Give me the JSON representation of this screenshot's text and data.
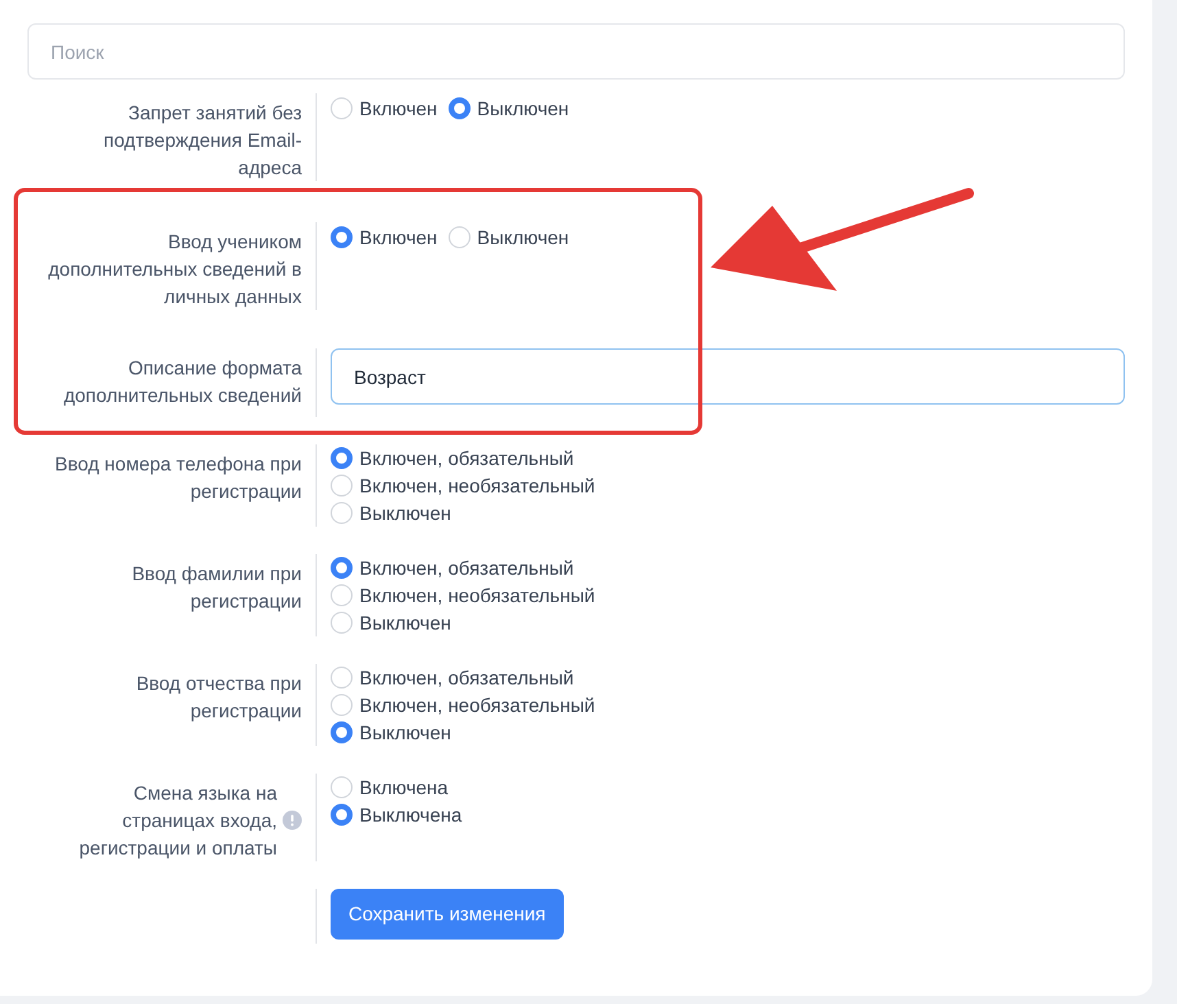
{
  "search": {
    "placeholder": "Поиск"
  },
  "settings": [
    {
      "kind": "radio_inline",
      "label": "Запрет занятий без подтверждения Email-адреса",
      "options": [
        {
          "label": "Включен",
          "selected": false
        },
        {
          "label": "Выключен",
          "selected": true
        }
      ]
    },
    {
      "kind": "radio_inline",
      "label": "Ввод учеником дополнительных сведений в личных данных",
      "highlighted": true,
      "options": [
        {
          "label": "Включен",
          "selected": true
        },
        {
          "label": "Выключен",
          "selected": false
        }
      ]
    },
    {
      "kind": "text",
      "label": "Описание формата дополнительных сведений",
      "highlighted": true,
      "value": "Возраст"
    },
    {
      "kind": "radio_stacked",
      "label": "Ввод номера телефона при регистрации",
      "options": [
        {
          "label": "Включен, обязательный",
          "selected": true
        },
        {
          "label": "Включен, необязательный",
          "selected": false
        },
        {
          "label": "Выключен",
          "selected": false
        }
      ]
    },
    {
      "kind": "radio_stacked",
      "label": "Ввод фамилии при регистрации",
      "options": [
        {
          "label": "Включен, обязательный",
          "selected": true
        },
        {
          "label": "Включен, необязательный",
          "selected": false
        },
        {
          "label": "Выключен",
          "selected": false
        }
      ]
    },
    {
      "kind": "radio_stacked",
      "label": "Ввод отчества при регистрации",
      "options": [
        {
          "label": "Включен, обязательный",
          "selected": false
        },
        {
          "label": "Включен, необязательный",
          "selected": false
        },
        {
          "label": "Выключен",
          "selected": true
        }
      ]
    },
    {
      "kind": "radio_stacked",
      "label": "Смена языка на страницах входа, регистрации и оплаты",
      "help_icon": true,
      "options": [
        {
          "label": "Включена",
          "selected": false
        },
        {
          "label": "Выключена",
          "selected": true
        }
      ]
    }
  ],
  "save_button": "Сохранить изменения"
}
